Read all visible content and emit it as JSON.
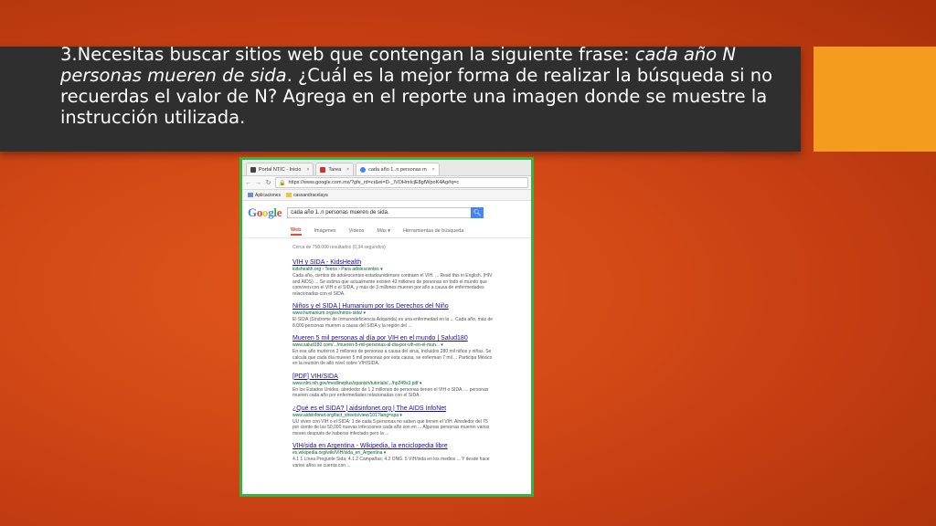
{
  "slide": {
    "title_part1": "3.Necesitas buscar sitios web que contengan la siguiente frase: ",
    "title_italic": "cada año N personas mueren de sida",
    "title_part2": ". ¿Cuál es la mejor forma de realizar la búsqueda si no recuerdas el valor de N? Agrega en el reporte una imagen donde se muestre la instrucción utilizada.",
    "accent_color": "#f39c1e",
    "frame_color": "#3cb043"
  },
  "browser": {
    "tabs": [
      {
        "label": "Portal NTIC - Inicio",
        "icon": "portal-favicon",
        "color": "#444"
      },
      {
        "label": "Tarea",
        "icon": "tarea-favicon",
        "color": "#c33"
      },
      {
        "label": "cada año 1..n personas m",
        "icon": "google-favicon",
        "color": "#4285f4"
      }
    ],
    "tab_close": "×",
    "url": "https://www.google.com.mx/?gfe_rd=cr&ei=D-_IVOHmIcjE8gfWpoK4Ag#q=c",
    "bookmarks": [
      "Aplicaciones",
      "cassandracelaya"
    ]
  },
  "google": {
    "logo_letters": [
      {
        "ch": "G",
        "color": "#4285f4"
      },
      {
        "ch": "o",
        "color": "#ea4335"
      },
      {
        "ch": "o",
        "color": "#fbbc05"
      },
      {
        "ch": "g",
        "color": "#4285f4"
      },
      {
        "ch": "l",
        "color": "#34a853"
      },
      {
        "ch": "e",
        "color": "#ea4335"
      }
    ],
    "query": "cada año 1..n personas mueren de sida.",
    "search_icon": "search-icon",
    "tabs": [
      "Web",
      "Imágenes",
      "Videos",
      "Más ▾",
      "Herramientas de búsqueda"
    ],
    "stats": "Cerca de 758.000 resultados (0,34 segundos)",
    "results": [
      {
        "title": "VIH y SIDA - KidsHealth",
        "url": "kidshealth.org › Teens › Para adolescentes ▾",
        "snippet": "Cada año, cientos de adolescentes estadounidenses contraen el VIH. ... Read this in English. (HIV and AIDS) ... Se estima que actualmente existen 42 millones de personas en todo el mundo que conviven con el VIH o el SIDA, y más de 3 millones mueren por año a causa de enfermedades relacionadas con el SIDA."
      },
      {
        "title": "Niños y el SIDA | Humanium por los Derechos del Niño",
        "url": "www.humanium.org/es/ninos-sida/ ▾",
        "snippet": "El SIDA (Síndrome de Inmunodeficiencia Adquirida) es una enfermedad en la ... Cada año, más de 8.000 personas mueren a causa del SIDA y la región del ..."
      },
      {
        "title": "Mueren 5 mil personas al día por VIH en el mundo | Salud180",
        "url": "www.salud180.com/.../mueren-5-mil-personas-al-dia-por-vih-en-el-mun... ▾",
        "snippet": "En ese año murieron 2 millones de personas a causa del virus, incluidos 280 mil niños y niñas. Se calcula que cada día mueren 5 mil personas por esta causa, se enferman 7 mil ... Participa México en la reunión de alto nivel sobre VIH/SIDA."
      },
      {
        "title": "[PDF] VIH/SIDA",
        "url": "www.nlm.nih.gov/medlineplus/spanish/tutorials/.../hp249s3.pdf ▾",
        "snippet": "En los Estados Unidos, alrededor de 1,2 millones de personas tienen el VIH o SIDA. ... personas mueren cada año por enfermedades relacionadas con el SIDA."
      },
      {
        "title": "¿Qué es el SIDA? | aidsinfonet.org | The AIDS InfoNet",
        "url": "www.aidsinfonet.org/fact_sheets/view/101?lang=spa ▾",
        "snippet": "UU viven con VIH o el SIDA: 1 de cada 5 personas no saben que tienen el VIH. Alrededor del 75 por ciento de las 50,000 nuevas infecciones cada año son en ... Algunas personas mueren varios meses después de haberse infectado pero la ..."
      },
      {
        "title": "VIH/sida en Argentina - Wikipedia, la enciclopedia libre",
        "url": "es.wikipedia.org/wiki/VIH/sida_en_Argentina ▾",
        "snippet": "4.1 1 Línea Pregunte Sida; 4.1.2 Campañas; 4.2 ONG. 5 VIH/sida en los medios ... Y desde hace varios años se cuenta con ..."
      }
    ]
  }
}
